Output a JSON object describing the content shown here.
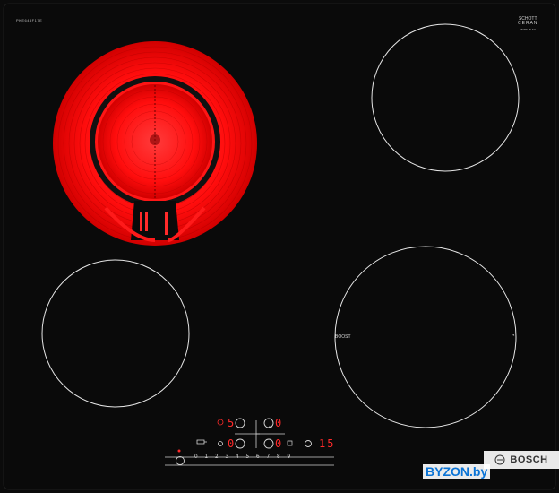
{
  "model_code": "PKE645F17E",
  "schott_brand": "SCHOTT",
  "ceran_brand": "CERAN",
  "schott_small": "MADE IN EU",
  "boost_label": "BOOST",
  "brand": "BOSCH",
  "watermark": "BYZON.by",
  "display": {
    "top_left_digit": "5",
    "top_right_digit": "0",
    "bottom_left_digit": "0",
    "bottom_right_digit": "0",
    "timer_digits": "15"
  },
  "scale": [
    "0",
    "1",
    "2",
    "3",
    "4",
    "5",
    "6",
    "7",
    "8",
    "9"
  ],
  "colors": {
    "glass": "#0a0a0a",
    "glow": "#ff1a1a",
    "ring": "#e6e6e6",
    "display_red": "#ff2a2a"
  }
}
